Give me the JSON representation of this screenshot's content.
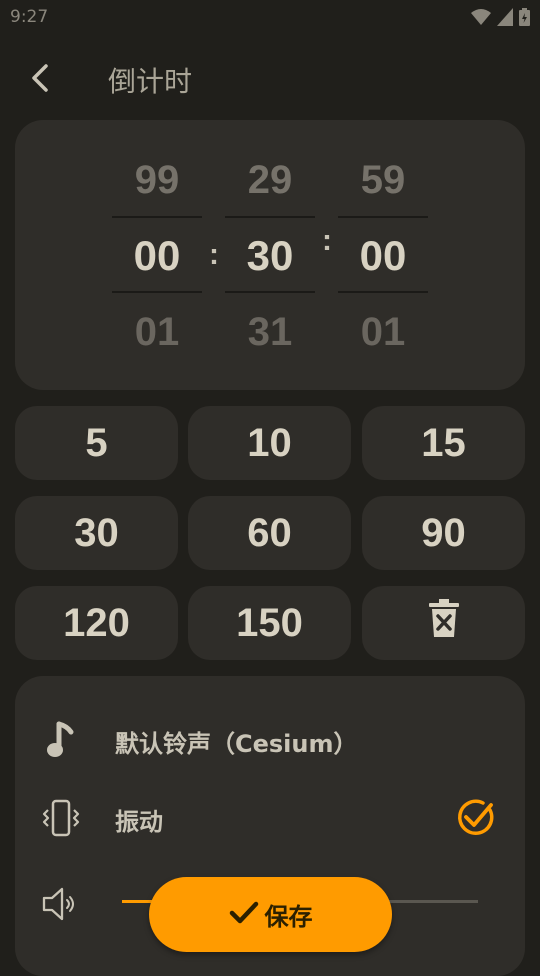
{
  "status_bar": {
    "time": "9:27"
  },
  "header": {
    "title": "倒计时"
  },
  "picker": {
    "hours": {
      "prev": "99",
      "current": "00",
      "next": "01"
    },
    "minutes": {
      "prev": "29",
      "current": "30",
      "next": "31"
    },
    "seconds": {
      "prev": "59",
      "current": "00",
      "next": "01"
    },
    "separator": ":"
  },
  "presets": [
    "5",
    "10",
    "15",
    "30",
    "60",
    "90",
    "120",
    "150"
  ],
  "settings": {
    "ringtone_label": "默认铃声（Cesium）",
    "vibrate_label": "振动",
    "vibrate_checked": true,
    "volume_percent": 12
  },
  "save_button": {
    "label": "保存"
  },
  "colors": {
    "accent": "#ff9b00",
    "background": "#201f1b",
    "surface": "#2f2d29",
    "text": "#c9c4b6"
  },
  "icons": {
    "back": "chevron-left-icon",
    "clear": "delete-x-icon",
    "ringtone": "music-note-icon",
    "vibrate": "vibrate-phone-icon",
    "vibrate_check": "circle-check-icon",
    "volume": "speaker-icon",
    "save": "check-icon"
  }
}
